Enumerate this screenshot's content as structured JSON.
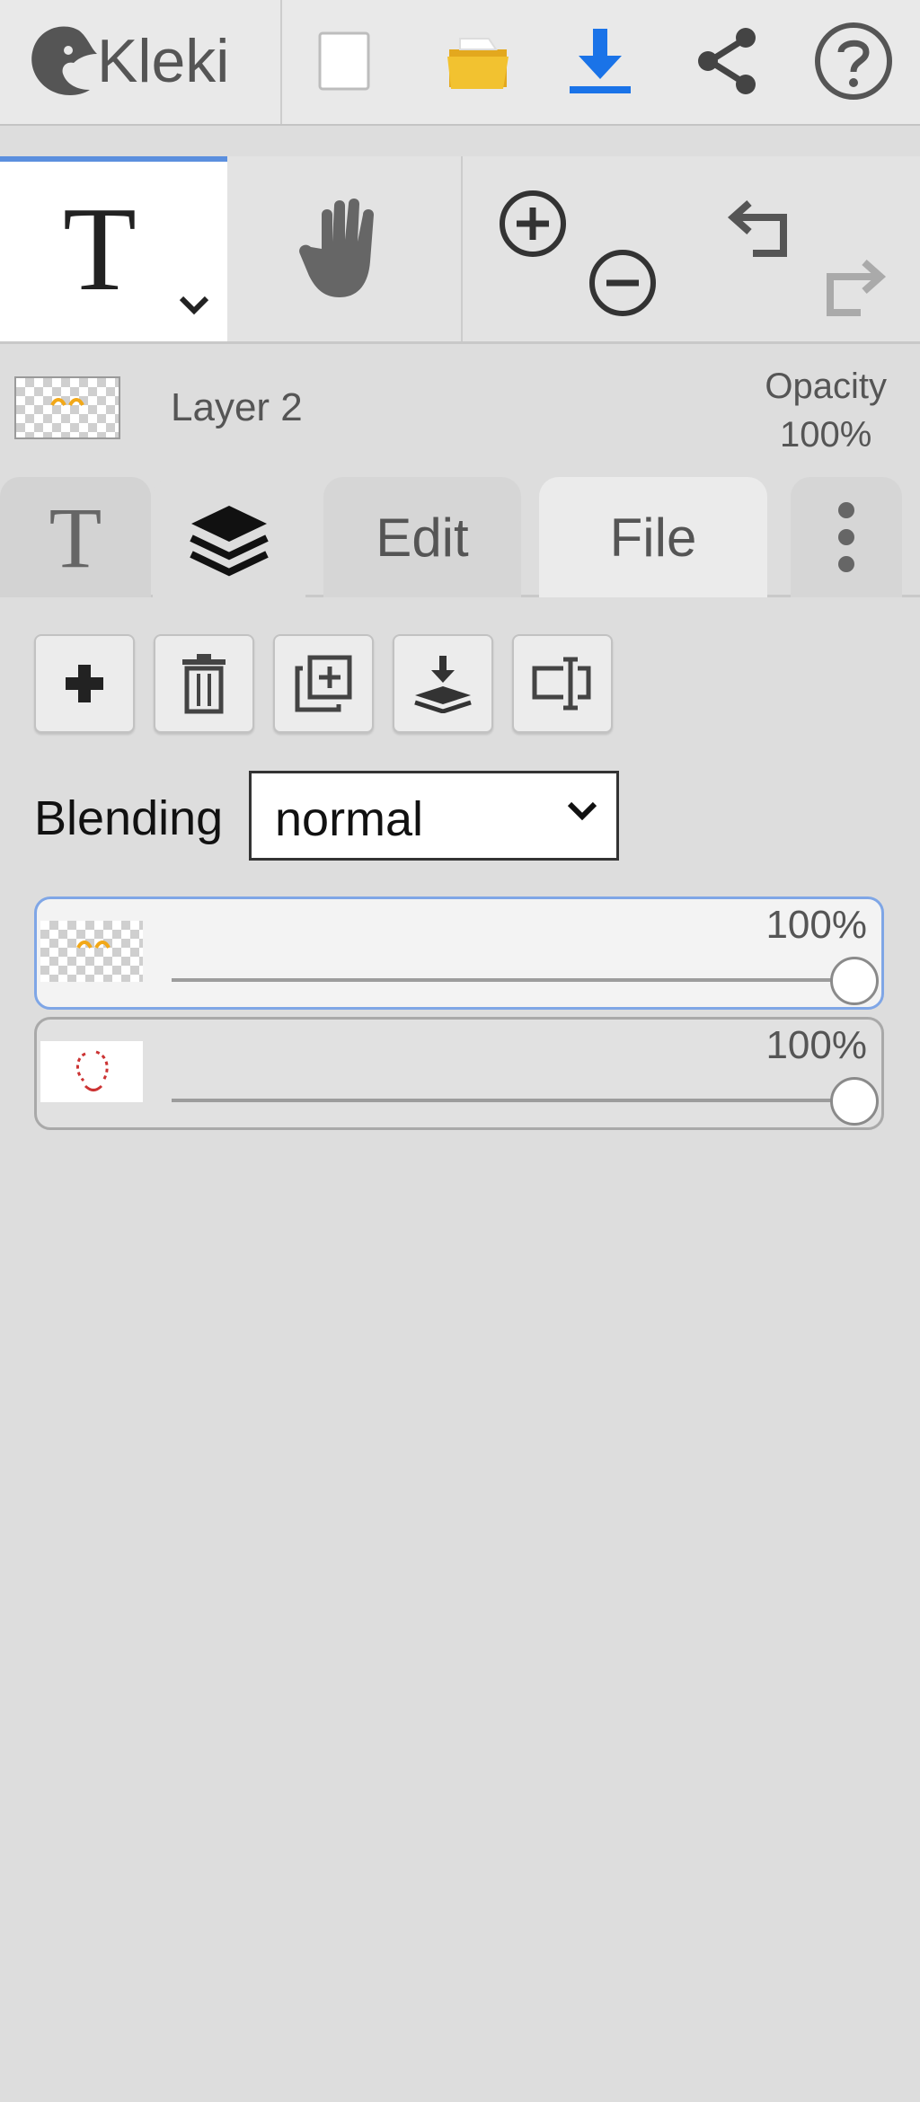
{
  "app": {
    "name": "Kleki",
    "logo_icon": "kleki-bird-logo"
  },
  "topbar": {
    "icons": [
      "new-file-icon",
      "open-folder-icon",
      "download-icon",
      "share-icon",
      "help-icon"
    ],
    "colors": {
      "folder": "#f2c230",
      "download": "#1a73e8"
    }
  },
  "toolbar": {
    "active_tool": "text",
    "text_tool_glyph": "T",
    "tools": [
      "text-tool",
      "hand-tool"
    ],
    "actions": [
      "zoom-in",
      "zoom-out",
      "undo",
      "redo"
    ],
    "accent": "#5b8fde"
  },
  "layer_info": {
    "name": "Layer 2",
    "opacity_label": "Opacity",
    "opacity_value": "100%"
  },
  "tabs": {
    "brush_glyph": "T",
    "layers_icon": "layers-icon",
    "edit": "Edit",
    "file": "File",
    "more_icon": "kebab-menu-icon",
    "active": "layers"
  },
  "layers_panel": {
    "buttons": [
      "add-layer",
      "delete-layer",
      "duplicate-layer",
      "merge-down",
      "rename-layer"
    ],
    "blending": {
      "label": "Blending",
      "value": "normal"
    },
    "layers": [
      {
        "opacity": "100%",
        "opacity_fraction": 1.0,
        "active": true
      },
      {
        "opacity": "100%",
        "opacity_fraction": 1.0,
        "active": false
      }
    ]
  }
}
